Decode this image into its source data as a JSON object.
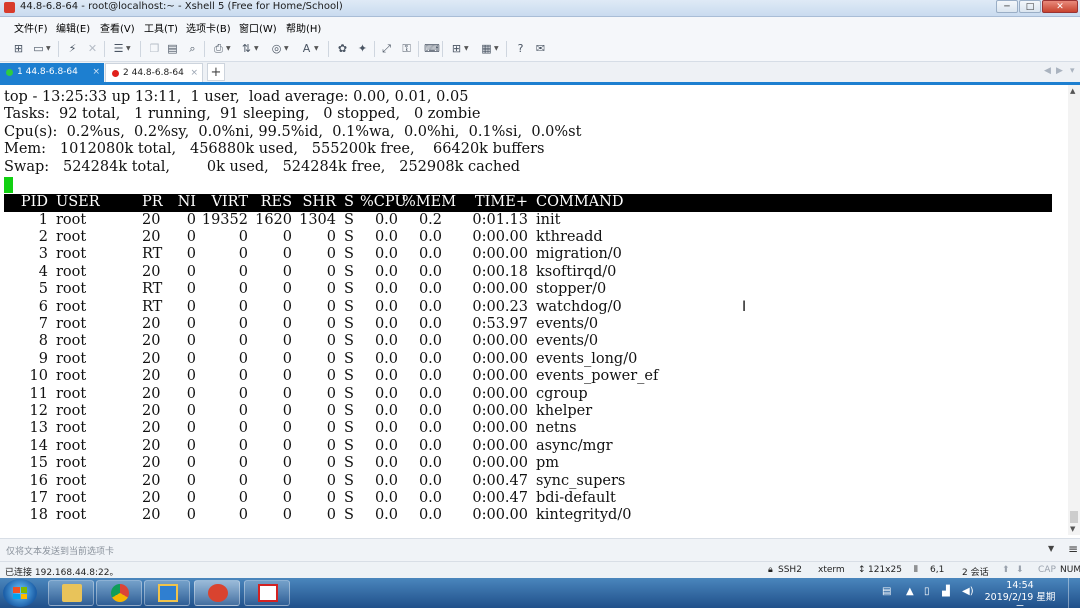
{
  "window": {
    "title": "44.8-6.8-64 - root@localhost:~ - Xshell 5 (Free for Home/School)",
    "min": "─",
    "max": "□",
    "close": "✕"
  },
  "menu": [
    "文件(F)",
    "编辑(E)",
    "查看(V)",
    "工具(T)",
    "选项卡(B)",
    "窗口(W)",
    "帮助(H)"
  ],
  "tabs": [
    {
      "label": "1 44.8-6.8-64",
      "status_color": "#2ecc40",
      "close": "×"
    },
    {
      "label": "2 44.8-6.8-64",
      "status_color": "#e0201b",
      "close": "×"
    }
  ],
  "tab_add": "+",
  "terminal": {
    "summary": [
      "top - 13:25:33 up 13:11,  1 user,  load average: 0.00, 0.01, 0.05",
      "Tasks:  92 total,   1 running,  91 sleeping,   0 stopped,   0 zombie",
      "Cpu(s):  0.2%us,  0.2%sy,  0.0%ni, 99.5%id,  0.1%wa,  0.0%hi,  0.1%si,  0.0%st",
      "Mem:   1012080k total,   456880k used,   555200k free,    66420k buffers",
      "Swap:   524284k total,        0k used,   524284k free,   252908k cached"
    ],
    "columns": {
      "pid": "PID",
      "user": "USER",
      "pr": "PR",
      "ni": "NI",
      "virt": "VIRT",
      "res": "RES",
      "shr": "SHR",
      "s": "S",
      "cpu": "%CPU",
      "mem": "%MEM",
      "time": "TIME+",
      "cmd": "COMMAND"
    },
    "processes": [
      {
        "pid": "1",
        "user": "root",
        "pr": "20",
        "ni": "0",
        "virt": "19352",
        "res": "1620",
        "shr": "1304",
        "s": "S",
        "cpu": "0.0",
        "mem": "0.2",
        "time": "0:01.13",
        "cmd": "init"
      },
      {
        "pid": "2",
        "user": "root",
        "pr": "20",
        "ni": "0",
        "virt": "0",
        "res": "0",
        "shr": "0",
        "s": "S",
        "cpu": "0.0",
        "mem": "0.0",
        "time": "0:00.00",
        "cmd": "kthreadd"
      },
      {
        "pid": "3",
        "user": "root",
        "pr": "RT",
        "ni": "0",
        "virt": "0",
        "res": "0",
        "shr": "0",
        "s": "S",
        "cpu": "0.0",
        "mem": "0.0",
        "time": "0:00.00",
        "cmd": "migration/0"
      },
      {
        "pid": "4",
        "user": "root",
        "pr": "20",
        "ni": "0",
        "virt": "0",
        "res": "0",
        "shr": "0",
        "s": "S",
        "cpu": "0.0",
        "mem": "0.0",
        "time": "0:00.18",
        "cmd": "ksoftirqd/0"
      },
      {
        "pid": "5",
        "user": "root",
        "pr": "RT",
        "ni": "0",
        "virt": "0",
        "res": "0",
        "shr": "0",
        "s": "S",
        "cpu": "0.0",
        "mem": "0.0",
        "time": "0:00.00",
        "cmd": "stopper/0"
      },
      {
        "pid": "6",
        "user": "root",
        "pr": "RT",
        "ni": "0",
        "virt": "0",
        "res": "0",
        "shr": "0",
        "s": "S",
        "cpu": "0.0",
        "mem": "0.0",
        "time": "0:00.23",
        "cmd": "watchdog/0"
      },
      {
        "pid": "7",
        "user": "root",
        "pr": "20",
        "ni": "0",
        "virt": "0",
        "res": "0",
        "shr": "0",
        "s": "S",
        "cpu": "0.0",
        "mem": "0.0",
        "time": "0:53.97",
        "cmd": "events/0"
      },
      {
        "pid": "8",
        "user": "root",
        "pr": "20",
        "ni": "0",
        "virt": "0",
        "res": "0",
        "shr": "0",
        "s": "S",
        "cpu": "0.0",
        "mem": "0.0",
        "time": "0:00.00",
        "cmd": "events/0"
      },
      {
        "pid": "9",
        "user": "root",
        "pr": "20",
        "ni": "0",
        "virt": "0",
        "res": "0",
        "shr": "0",
        "s": "S",
        "cpu": "0.0",
        "mem": "0.0",
        "time": "0:00.00",
        "cmd": "events_long/0"
      },
      {
        "pid": "10",
        "user": "root",
        "pr": "20",
        "ni": "0",
        "virt": "0",
        "res": "0",
        "shr": "0",
        "s": "S",
        "cpu": "0.0",
        "mem": "0.0",
        "time": "0:00.00",
        "cmd": "events_power_ef"
      },
      {
        "pid": "11",
        "user": "root",
        "pr": "20",
        "ni": "0",
        "virt": "0",
        "res": "0",
        "shr": "0",
        "s": "S",
        "cpu": "0.0",
        "mem": "0.0",
        "time": "0:00.00",
        "cmd": "cgroup"
      },
      {
        "pid": "12",
        "user": "root",
        "pr": "20",
        "ni": "0",
        "virt": "0",
        "res": "0",
        "shr": "0",
        "s": "S",
        "cpu": "0.0",
        "mem": "0.0",
        "time": "0:00.00",
        "cmd": "khelper"
      },
      {
        "pid": "13",
        "user": "root",
        "pr": "20",
        "ni": "0",
        "virt": "0",
        "res": "0",
        "shr": "0",
        "s": "S",
        "cpu": "0.0",
        "mem": "0.0",
        "time": "0:00.00",
        "cmd": "netns"
      },
      {
        "pid": "14",
        "user": "root",
        "pr": "20",
        "ni": "0",
        "virt": "0",
        "res": "0",
        "shr": "0",
        "s": "S",
        "cpu": "0.0",
        "mem": "0.0",
        "time": "0:00.00",
        "cmd": "async/mgr"
      },
      {
        "pid": "15",
        "user": "root",
        "pr": "20",
        "ni": "0",
        "virt": "0",
        "res": "0",
        "shr": "0",
        "s": "S",
        "cpu": "0.0",
        "mem": "0.0",
        "time": "0:00.00",
        "cmd": "pm"
      },
      {
        "pid": "16",
        "user": "root",
        "pr": "20",
        "ni": "0",
        "virt": "0",
        "res": "0",
        "shr": "0",
        "s": "S",
        "cpu": "0.0",
        "mem": "0.0",
        "time": "0:00.47",
        "cmd": "sync_supers"
      },
      {
        "pid": "17",
        "user": "root",
        "pr": "20",
        "ni": "0",
        "virt": "0",
        "res": "0",
        "shr": "0",
        "s": "S",
        "cpu": "0.0",
        "mem": "0.0",
        "time": "0:00.47",
        "cmd": "bdi-default"
      },
      {
        "pid": "18",
        "user": "root",
        "pr": "20",
        "ni": "0",
        "virt": "0",
        "res": "0",
        "shr": "0",
        "s": "S",
        "cpu": "0.0",
        "mem": "0.0",
        "time": "0:00.00",
        "cmd": "kintegrityd/0"
      }
    ]
  },
  "send_bar": {
    "placeholder": "仅将文本发送到当前选项卡"
  },
  "status": {
    "connection": "已连接 192.168.44.8:22。",
    "protocol": "SSH2",
    "terminal_type": "xterm",
    "size": "121x25",
    "cursor_pos": "6,1",
    "sessions": "2 会话",
    "caps": "CAP",
    "num": "NUM"
  },
  "clock": {
    "time": "14:54",
    "date": "2019/2/19 星期二"
  },
  "colors": {
    "accent": "#1d7fd0",
    "cursor": "#11d011",
    "header_bg": "#000000"
  }
}
